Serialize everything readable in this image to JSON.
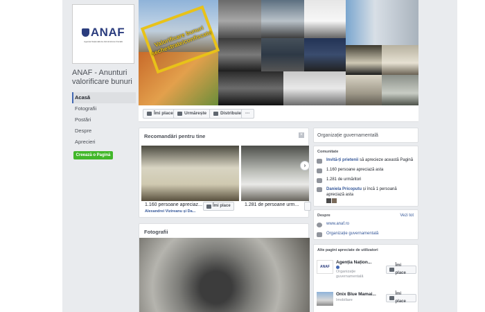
{
  "sidebar": {
    "logo_text": "ANAF",
    "logo_subtitle": "Agenția Națională de Administrare Fiscală",
    "page_name": "ANAF - Anunturi valorificare bunuri",
    "nav": [
      "Acasă",
      "Fotografii",
      "Postări",
      "Despre",
      "Aprecieri"
    ],
    "create_page": "Creează o Pagină"
  },
  "cover": {
    "stamp_text": "Valorificare bunuri sechestrate/confiscate"
  },
  "actions": {
    "like": "Îmi place",
    "follow": "Urmărește",
    "share": "Distribuie",
    "more": "···"
  },
  "recommendations": {
    "title": "Recomandări pentru tine",
    "card1_caption": "1.160 persoane apreciaz...",
    "card1_sub": "Alexandrei Vizireanu și Da...",
    "card1_like": "Îmi place",
    "card2_caption": "1.281 de persoane urm...",
    "close": "×",
    "arrow": "›"
  },
  "photos": {
    "title": "Fotografii"
  },
  "about_top": {
    "category": "Organizație guvernamentală"
  },
  "community": {
    "title": "Comunitate",
    "invite_link": "Invită-ți prietenii",
    "invite_rest": " să aprecieze această Pagină",
    "likes": "1.160 persoane apreciază asta",
    "followers": "1.281 de urmăritori",
    "friend_link": "Daniela Pricoputu",
    "friend_rest": " și încă 1 persoană apreciază asta"
  },
  "about": {
    "title": "Despre",
    "see_all": "Vezi tot",
    "website": "www.anaf.ro",
    "category": "Organizație guvernamentală"
  },
  "other_pages": {
    "title": "Alte pagini apreciate de utilizatori",
    "items": [
      {
        "name": "Agenția Națion...",
        "category": "Organizație guvernamentală",
        "like": "Îmi place"
      },
      {
        "name": "Onix Blue Mamai...",
        "category": "Imobiliare",
        "like": "Îmi place"
      }
    ]
  }
}
